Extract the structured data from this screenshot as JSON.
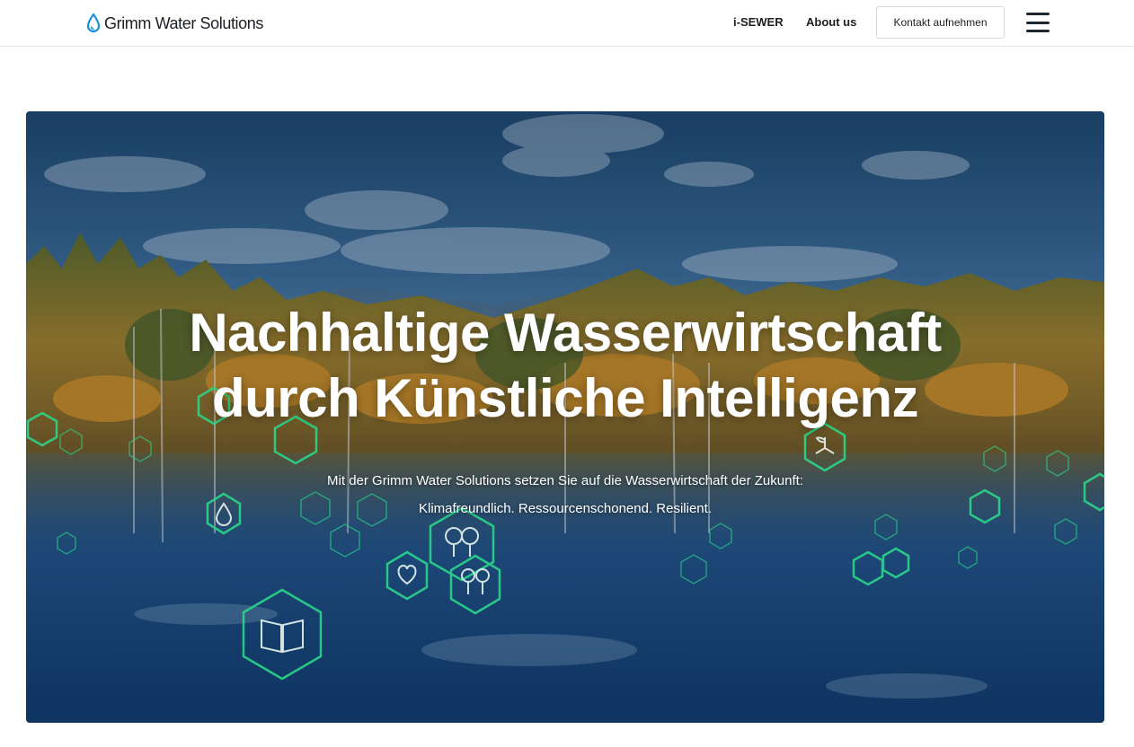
{
  "header": {
    "brand": "Grimm Water Solutions",
    "logo_icon": "water-drop-icon",
    "nav": {
      "isewer": "i-SEWER",
      "about": "About us"
    },
    "contact_label": "Kontakt aufnehmen",
    "menu_icon": "hamburger-menu-icon"
  },
  "hero": {
    "title_line1": "Nachhaltige Wasserwirtschaft",
    "title_line2": "durch Künstliche Intelligenz",
    "subtitle_line1": "Mit der Grimm Water Solutions setzen Sie auf die Wasserwirtschaft der Zukunft:",
    "subtitle_line2": "Klimafreundlich. Ressourcenschonend. Resilient.",
    "overlay_icons": [
      "tree-icon",
      "heart-pulse-icon",
      "open-book-icon",
      "water-drop-icon",
      "plant-hand-icon",
      "cutlery-icon",
      "recycle-icon"
    ]
  },
  "colors": {
    "accent_brand": "#1a8fd8",
    "hex_stroke": "#2bd68a",
    "sky": "#2f5a86",
    "text_dark": "#1c1f23"
  }
}
